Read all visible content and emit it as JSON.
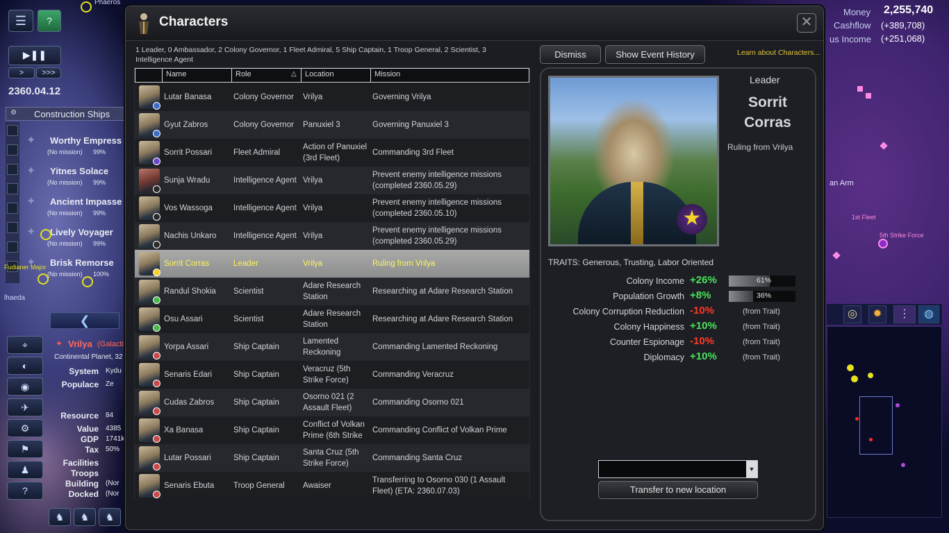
{
  "hud": {
    "date": "2360.04.12",
    "money_label": "Money",
    "money_value": "2,255,740",
    "cashflow_label": "Cashflow",
    "cashflow_value": "(+389,708)",
    "bonus_income_label": "us Income",
    "bonus_income_value": "(+251,068)",
    "play_symbol": "▶❚❚",
    "speed_down": ">",
    "speed_up": ">>>",
    "collapse_arrow": "❮"
  },
  "ship_list": {
    "header": "Construction Ships",
    "items": [
      {
        "name": "Worthy Empress",
        "status": "(No mission)",
        "pct": "99%"
      },
      {
        "name": "Yitnes Solace",
        "status": "(No mission)",
        "pct": "99%"
      },
      {
        "name": "Ancient Impasse",
        "status": "(No mission)",
        "pct": "99%"
      },
      {
        "name": "Lively Voyager",
        "status": "(No mission)",
        "pct": "99%"
      },
      {
        "name": "Brisk Remorse",
        "status": "(No mission)",
        "pct": "100%"
      }
    ]
  },
  "map_labels": {
    "phaeros": "Phaeros",
    "haeda": "lhaeda",
    "fudianer": "Fudianer Major",
    "arm": "an Arm",
    "first_fleet": "1st Fleet",
    "strike_force": "5th Strike Force"
  },
  "colony": {
    "name": "Vrilya",
    "tag": "(Galacti",
    "type": "Continental Planet, 32",
    "rows": [
      {
        "label": "System",
        "value": "Kydu"
      },
      {
        "label": "Populace",
        "value": "Ze"
      },
      {
        "label": "Resource",
        "value": "84"
      },
      {
        "label": "Value",
        "value": "4385"
      },
      {
        "label": "GDP",
        "value": "1741k"
      },
      {
        "label": "Tax",
        "value": "50%"
      },
      {
        "label": "Facilities",
        "value": ""
      },
      {
        "label": "Troops",
        "value": ""
      },
      {
        "label": "Building",
        "value": "(Nor"
      },
      {
        "label": "Docked",
        "value": "(Nor"
      }
    ]
  },
  "window": {
    "title": "Characters",
    "close": "✕",
    "summary": "1 Leader, 0 Ambassador, 2 Colony Governor, 1 Fleet Admiral, 5 Ship Captain, 1 Troop General, 2 Scientist, 3 Intelligence Agent",
    "dismiss": "Dismiss",
    "history": "Show Event History",
    "learn": "Learn about Characters..."
  },
  "table": {
    "columns": [
      "Name",
      "Role",
      "Location",
      "Mission"
    ],
    "sort_indicator": "△",
    "rows": [
      {
        "name": "Lutar Banasa",
        "role": "Colony Governor",
        "location": "Vrilya",
        "mission": "Governing Vrilya"
      },
      {
        "name": "Gyut Zabros",
        "role": "Colony Governor",
        "location": "Panuxiel 3",
        "mission": "Governing Panuxiel 3"
      },
      {
        "name": "Sorrit Possari",
        "role": "Fleet Admiral",
        "location": "Action of Panuxiel (3rd Fleet)",
        "mission": "Commanding 3rd Fleet"
      },
      {
        "name": "Sunja Wradu",
        "role": "Intelligence Agent",
        "location": "Vrilya",
        "mission": "Prevent enemy intelligence missions (completed 2360.05.29)"
      },
      {
        "name": "Vos Wassoga",
        "role": "Intelligence Agent",
        "location": "Vrilya",
        "mission": "Prevent enemy intelligence missions (completed 2360.05.10)"
      },
      {
        "name": "Nachis Unkaro",
        "role": "Intelligence Agent",
        "location": "Vrilya",
        "mission": "Prevent enemy intelligence missions (completed 2360.05.29)"
      },
      {
        "name": "Sorrit Corras",
        "role": "Leader",
        "location": "Vrilya",
        "mission": "Ruling from Vrilya"
      },
      {
        "name": "Randul Shokia",
        "role": "Scientist",
        "location": "Adare Research Station",
        "mission": "Researching at Adare Research Station"
      },
      {
        "name": "Osu Assari",
        "role": "Scientist",
        "location": "Adare Research Station",
        "mission": "Researching at Adare Research Station"
      },
      {
        "name": "Yorpa Assari",
        "role": "Ship Captain",
        "location": "Lamented Reckoning",
        "mission": "Commanding Lamented Reckoning"
      },
      {
        "name": "Senaris Edari",
        "role": "Ship Captain",
        "location": "Veracruz (5th Strike Force)",
        "mission": "Commanding Veracruz"
      },
      {
        "name": "Cudas Zabros",
        "role": "Ship Captain",
        "location": "Osorno 021 (2 Assault Fleet)",
        "mission": "Commanding Osorno 021"
      },
      {
        "name": "Xa Banasa",
        "role": "Ship Captain",
        "location": "Conflict of Volkan Prime (6th Strike",
        "mission": "Commanding Conflict of Volkan Prime"
      },
      {
        "name": "Lutar Possari",
        "role": "Ship Captain",
        "location": "Santa Cruz (5th Strike Force)",
        "mission": "Commanding Santa Cruz"
      },
      {
        "name": "Senaris Ebuta",
        "role": "Troop General",
        "location": "Awaiser",
        "mission": "Transferring to Osorno 030 (1 Assault Fleet) (ETA: 2360.07.03)"
      }
    ]
  },
  "detail": {
    "role": "Leader",
    "name": "Sorrit Corras",
    "status": "Ruling from Vrilya",
    "traits": "TRAITS: Generous, Trusting, Labor Oriented",
    "star": "★",
    "bonuses": [
      {
        "label": "Colony Income",
        "value": "+26%",
        "bar_text": "61%",
        "bar_fraction": 0.61,
        "sign": "pos"
      },
      {
        "label": "Population Growth",
        "value": "+8%",
        "bar_text": "36%",
        "bar_fraction": 0.36,
        "sign": "pos"
      },
      {
        "label": "Colony Corruption Reduction",
        "value": "-10%",
        "from": "(from Trait)",
        "sign": "neg"
      },
      {
        "label": "Colony Happiness",
        "value": "+10%",
        "from": "(from Trait)",
        "sign": "pos"
      },
      {
        "label": "Counter Espionage",
        "value": "-10%",
        "from": "(from Trait)",
        "sign": "neg"
      },
      {
        "label": "Diplomacy",
        "value": "+10%",
        "from": "(from Trait)",
        "sign": "pos"
      }
    ],
    "select_value": "",
    "select_arrow": "▼",
    "transfer": "Transfer to new location"
  }
}
